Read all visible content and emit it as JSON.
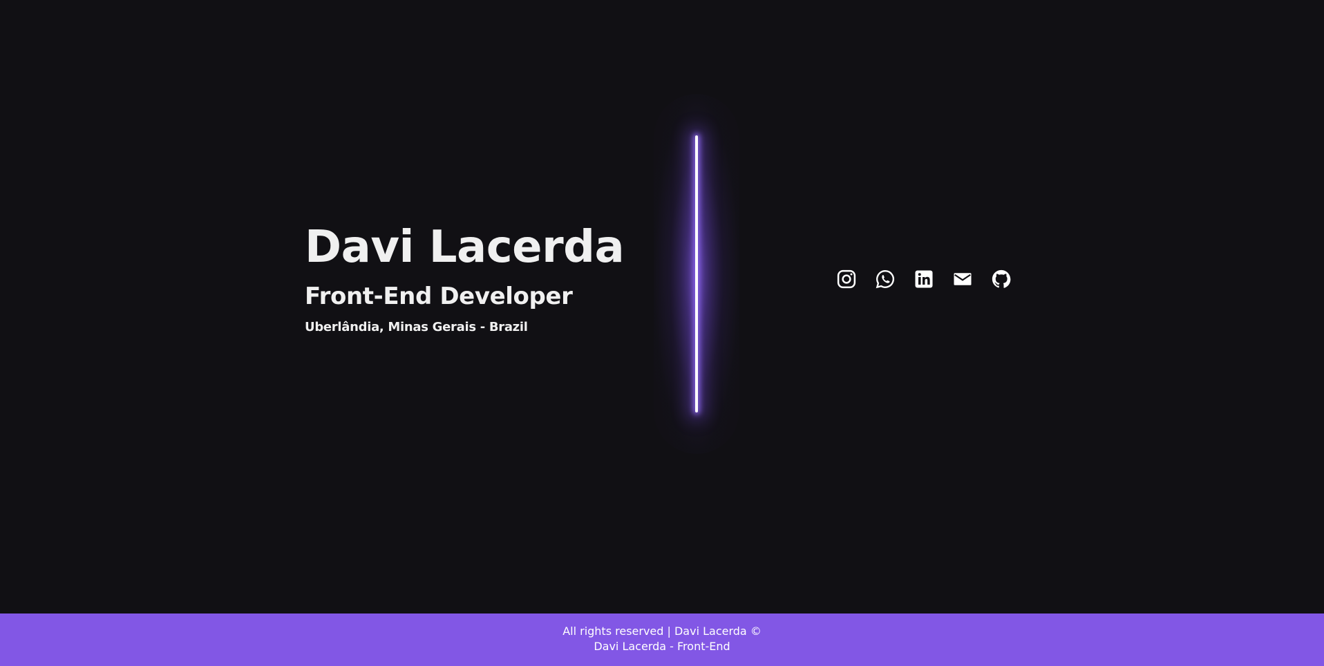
{
  "hero": {
    "name": "Davi Lacerda",
    "role": "Front-End Developer",
    "location": "Uberlândia, Minas Gerais - Brazil"
  },
  "socials": [
    {
      "icon": "instagram-icon"
    },
    {
      "icon": "whatsapp-icon"
    },
    {
      "icon": "linkedin-icon"
    },
    {
      "icon": "email-icon"
    },
    {
      "icon": "github-icon"
    }
  ],
  "footer": {
    "line1": "All rights reserved | Davi Lacerda ©",
    "line2": "Davi Lacerda - Front-End"
  },
  "colors": {
    "background": "#111014",
    "accent": "#8257e5",
    "text": "#f0f0f0"
  }
}
